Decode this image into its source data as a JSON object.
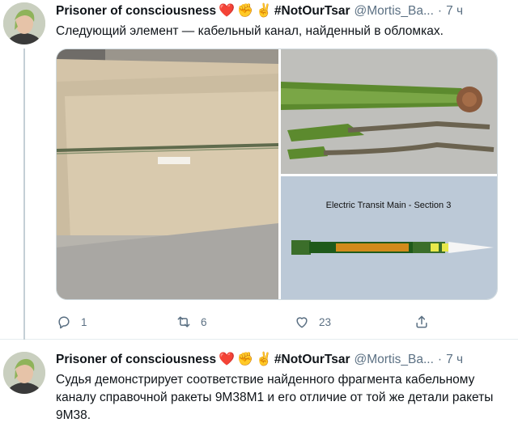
{
  "tweets": [
    {
      "author": {
        "name": "Prisoner of consciousness",
        "emojis": [
          "❤️",
          "✊",
          "✌️"
        ],
        "hashtag": "#NotOurTsar",
        "handle": "@Mortis_Ba...",
        "time": "7 ч"
      },
      "text": "Следующий элемент — кабельный канал, найденный в обломках.",
      "media": {
        "diagram_title": "Electric Transit Main - Section 3"
      },
      "actions": {
        "replies": "1",
        "retweets": "6",
        "likes": "23"
      }
    },
    {
      "author": {
        "name": "Prisoner of consciousness",
        "emojis": [
          "❤️",
          "✊",
          "✌️"
        ],
        "hashtag": "#NotOurTsar",
        "handle": "@Mortis_Ba...",
        "time": "7 ч"
      },
      "text": "Судья демонстрирует соответствие найденного фрагмента кабельному каналу справочной ракеты 9М38М1 и его отличие от той же детали ракеты 9М38."
    }
  ],
  "colors": {
    "text": "#0f1419",
    "secondary": "#5b7083",
    "border": "#e6ecf0",
    "heart": "#e0245e"
  },
  "icons": [
    "reply-icon",
    "retweet-icon",
    "like-icon",
    "share-icon"
  ]
}
